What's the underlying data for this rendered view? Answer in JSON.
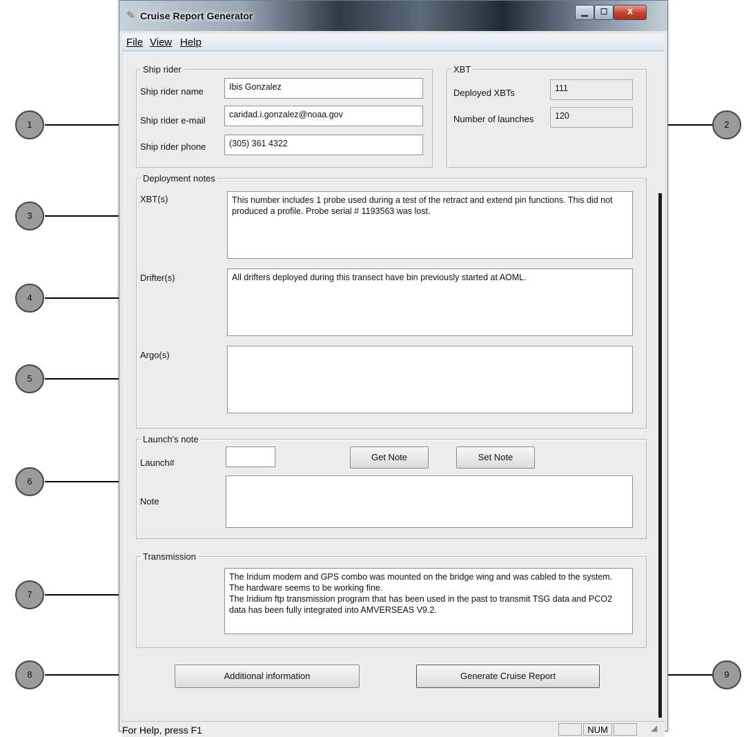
{
  "window": {
    "title": "Cruise Report Generator",
    "controls": {
      "minimize": "▁",
      "maximize": "☐",
      "close": "X"
    }
  },
  "menu": [
    "File",
    "View",
    "Help"
  ],
  "ship_rider": {
    "legend": "Ship rider",
    "name_label": "Ship rider name",
    "name_value": "Ibis Gonzalez",
    "email_label": "Ship rider e-mail",
    "email_value": "caridad.i.gonzalez@noaa.gov",
    "phone_label": "Ship rider phone",
    "phone_value": "(305) 361 4322"
  },
  "xbt": {
    "legend": "XBT",
    "deployed_label": "Deployed XBTs",
    "deployed_value": "111",
    "launches_label": "Number of launches",
    "launches_value": "120"
  },
  "deployment_notes": {
    "legend": "Deployment notes",
    "xbt_label": "XBT(s)",
    "xbt_text": "This number includes 1 probe used during a test of the retract and extend pin functions. This did not produced a profile. Probe serial # 1193563 was lost.",
    "drifter_label": "Drifter(s)",
    "drifter_text": "All drifters deployed during this transect have bin previously started at AOML.",
    "argo_label": "Argo(s)",
    "argo_text": ""
  },
  "launch_note": {
    "legend": "Launch's note",
    "launch_label": "Launch#",
    "launch_value": "",
    "get_button": "Get Note",
    "set_button": "Set Note",
    "note_label": "Note",
    "note_value": ""
  },
  "transmission": {
    "legend": "Transmission",
    "text": "The Iridum modem and GPS combo was mounted on the bridge wing and was cabled to the system. The hardware seems to be working fine.\nThe Iridium ftp transmission program that has been used in the past to transmit TSG data and PCO2 data has been fully integrated into AMVERSEAS V9.2."
  },
  "buttons": {
    "additional": "Additional information",
    "generate": "Generate Cruise Report"
  },
  "status": {
    "help": "For Help, press F1",
    "num": "NUM"
  },
  "callouts": [
    "1",
    "2",
    "3",
    "4",
    "5",
    "6",
    "7",
    "8",
    "9"
  ]
}
